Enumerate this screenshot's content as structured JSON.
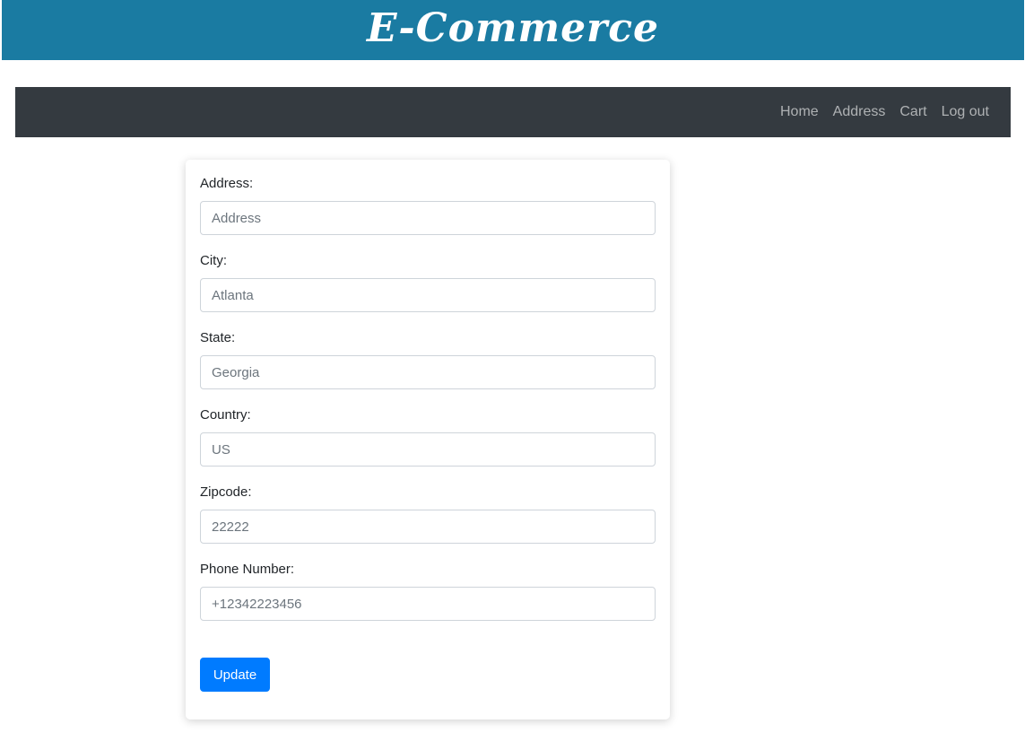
{
  "header": {
    "title": "E-Commerce"
  },
  "nav": {
    "items": [
      {
        "label": "Home"
      },
      {
        "label": "Address"
      },
      {
        "label": "Cart"
      },
      {
        "label": "Log out"
      }
    ]
  },
  "form": {
    "fields": [
      {
        "label": "Address:",
        "value": "",
        "placeholder": "Address"
      },
      {
        "label": "City:",
        "value": "",
        "placeholder": "Atlanta"
      },
      {
        "label": "State:",
        "value": "",
        "placeholder": "Georgia"
      },
      {
        "label": "Country:",
        "value": "",
        "placeholder": "US"
      },
      {
        "label": "Zipcode:",
        "value": "",
        "placeholder": "22222"
      },
      {
        "label": "Phone Number:",
        "value": "",
        "placeholder": "+12342223456"
      }
    ],
    "submit_label": "Update"
  },
  "colors": {
    "banner": "#1a7ba2",
    "navbar": "#343a40",
    "primary_button": "#007bff"
  }
}
